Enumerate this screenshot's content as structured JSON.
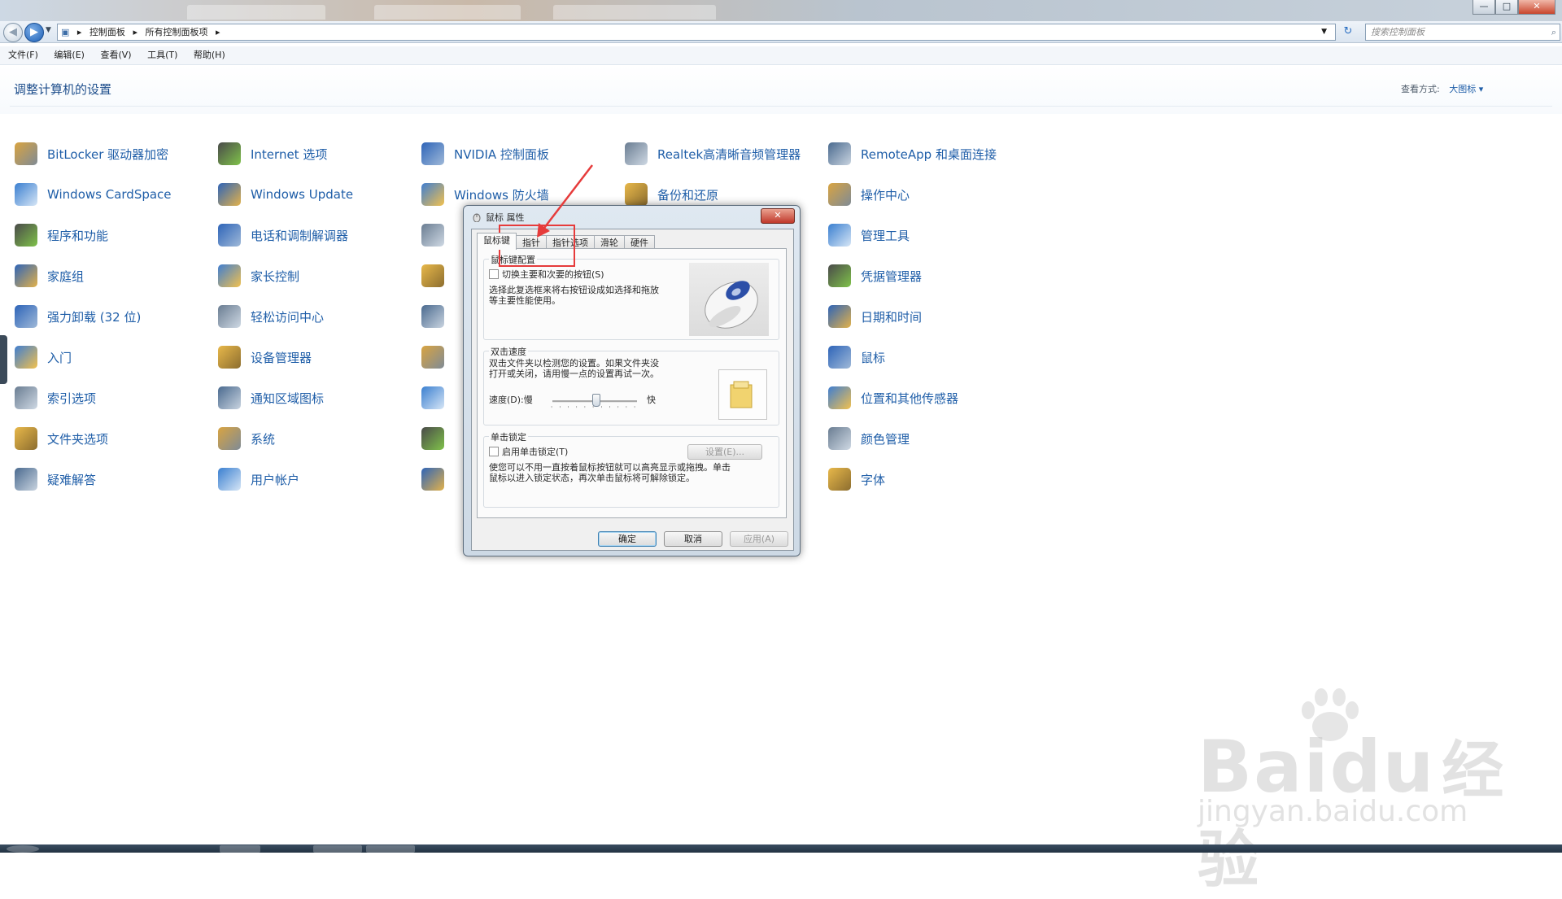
{
  "breadcrumb": {
    "root": "控制面板",
    "current": "所有控制面板项"
  },
  "search": {
    "placeholder": "搜索控制面板"
  },
  "menu": [
    "文件(F)",
    "编辑(E)",
    "查看(V)",
    "工具(T)",
    "帮助(H)"
  ],
  "page_title": "调整计算机的设置",
  "view_by": {
    "label": "查看方式:",
    "value": "大图标 ▾"
  },
  "control_panel_items": {
    "col1": [
      "BitLocker 驱动器加密",
      "Windows CardSpace",
      "程序和功能",
      "家庭组",
      "强力卸载 (32 位)",
      "入门",
      "索引选项",
      "文件夹选项",
      "疑难解答"
    ],
    "col2": [
      "Internet 选项",
      "Windows Update",
      "电话和调制解调器",
      "家长控制",
      "轻松访问中心",
      "设备管理器",
      "通知区域图标",
      "系统",
      "用户帐户"
    ],
    "col3": [
      "NVIDIA 控制面板",
      "Windows 防火墙",
      "",
      "",
      "",
      "",
      "",
      "",
      ""
    ],
    "col4": [
      "Realtek高清晰音频管理器",
      "备份和还原",
      "",
      "",
      "",
      "",
      "",
      "",
      ""
    ],
    "col5": [
      "RemoteApp 和桌面连接",
      "操作中心",
      "管理工具",
      "凭据管理器",
      "日期和时间",
      "鼠标",
      "位置和其他传感器",
      "颜色管理",
      "字体"
    ]
  },
  "dialog": {
    "title": "鼠标 属性",
    "close": "✕",
    "tabs": [
      "鼠标键",
      "指针",
      "指针选项",
      "滑轮",
      "硬件"
    ],
    "button_config": {
      "group": "鼠标键配置",
      "checkbox": "切换主要和次要的按钮(S)",
      "desc_1": "选择此复选框来将右按钮设成如选择和拖放",
      "desc_2": "等主要性能使用。"
    },
    "double_click": {
      "group": "双击速度",
      "desc_1": "双击文件夹以检测您的设置。如果文件夹没",
      "desc_2": "打开或关闭，请用慢一点的设置再试一次。",
      "speed_label": "速度(D):慢",
      "fast": "快",
      "speed_value": 0.52
    },
    "click_lock": {
      "group": "单击锁定",
      "checkbox": "启用单击锁定(T)",
      "settings_button": "设置(E)...",
      "desc_1": "使您可以不用一直按着鼠标按钮就可以高亮显示或拖拽。单击",
      "desc_2": "鼠标以进入锁定状态，再次单击鼠标将可解除锁定。"
    },
    "buttons": {
      "ok": "确定",
      "cancel": "取消",
      "apply": "应用(A)"
    }
  },
  "watermark": {
    "brand": "Bai",
    "brand_2": "du",
    "cn": "经验",
    "url": "jingyan.baidu.com"
  },
  "colors": {
    "link": "#1f5ea8",
    "annotation": "#e63b3b"
  }
}
